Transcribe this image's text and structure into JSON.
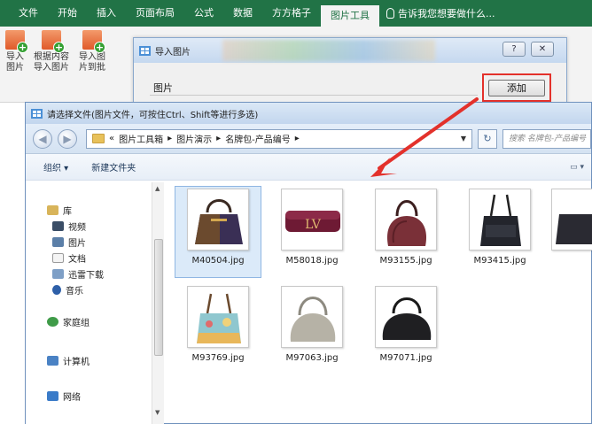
{
  "ribbon": {
    "tabs": [
      "文件",
      "开始",
      "插入",
      "页面布局",
      "公式",
      "数据",
      "方方格子",
      "图片工具"
    ],
    "active_tab": "图片工具",
    "tell_me": "告诉我您想要做什么...",
    "accent_color": "#217346",
    "buttons": [
      {
        "line1": "导入",
        "line2": "图片",
        "icon": "import-picture-icon"
      },
      {
        "line1": "根据内容",
        "line2": "导入图片",
        "icon": "import-by-content-icon"
      },
      {
        "line1": "导入图",
        "line2": "片到批",
        "icon": "import-to-comment-icon"
      }
    ]
  },
  "import_dialog": {
    "title": "导入图片",
    "field_label": "图片",
    "add_button": "添加",
    "help_button": "?",
    "close_button": "✕"
  },
  "file_dialog": {
    "title": "请选择文件(图片文件，可按住Ctrl、Shift等进行多选)",
    "breadcrumb_prefix": "«",
    "breadcrumb": [
      "图片工具箱",
      "图片演示",
      "名牌包-产品编号"
    ],
    "search_placeholder": "搜索 名牌包-产品编号",
    "toolbar": {
      "organize": "组织 ▾",
      "new_folder": "新建文件夹"
    },
    "sidebar": [
      {
        "label": "库",
        "icon": "library-icon",
        "sub": false
      },
      {
        "label": "视频",
        "icon": "video-icon",
        "sub": true
      },
      {
        "label": "图片",
        "icon": "pictures-icon",
        "sub": true
      },
      {
        "label": "文档",
        "icon": "documents-icon",
        "sub": true
      },
      {
        "label": "迅雷下载",
        "icon": "thunder-download-icon",
        "sub": true
      },
      {
        "label": "音乐",
        "icon": "music-icon",
        "sub": true
      },
      {
        "label": "家庭组",
        "icon": "homegroup-icon",
        "sub": false
      },
      {
        "label": "计算机",
        "icon": "computer-icon",
        "sub": false
      },
      {
        "label": "网络",
        "icon": "network-icon",
        "sub": false
      }
    ],
    "files": [
      {
        "name": "M40504.jpg",
        "selected": true
      },
      {
        "name": "M58018.jpg",
        "selected": false
      },
      {
        "name": "M93155.jpg",
        "selected": false
      },
      {
        "name": "M93415.jpg",
        "selected": false
      },
      {
        "name": "M93769.jpg",
        "selected": false
      },
      {
        "name": "M97063.jpg",
        "selected": false
      },
      {
        "name": "M97071.jpg",
        "selected": false
      }
    ]
  },
  "annotation_color": "#e3312b"
}
